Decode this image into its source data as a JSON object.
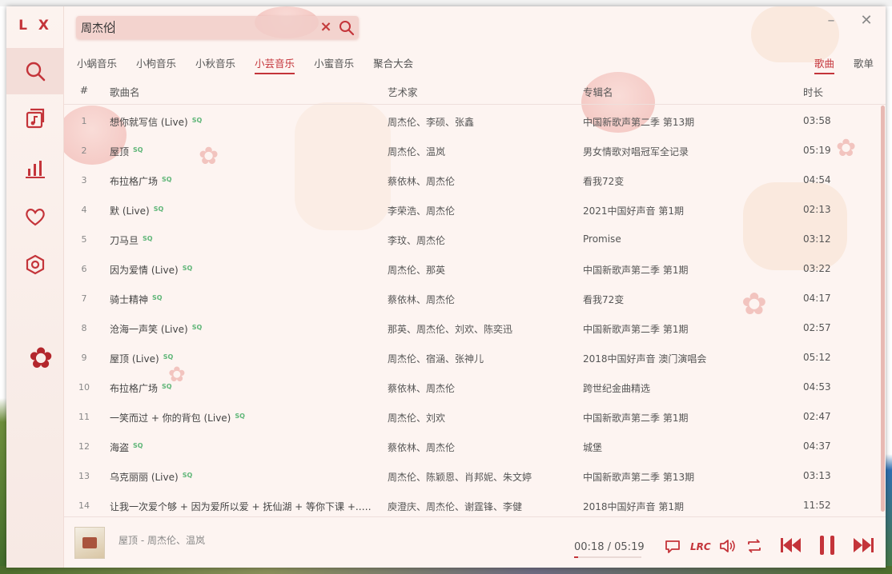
{
  "app": {
    "logo": "L X"
  },
  "sidebar": {
    "items": [
      {
        "name": "search",
        "icon": "search-icon",
        "active": true
      },
      {
        "name": "song-list",
        "icon": "music-list-icon",
        "active": false
      },
      {
        "name": "leaderboard",
        "icon": "bar-chart-icon",
        "active": false
      },
      {
        "name": "favorites",
        "icon": "heart-icon",
        "active": false
      },
      {
        "name": "settings",
        "icon": "settings-icon",
        "active": false
      }
    ]
  },
  "search": {
    "value": "周杰伦"
  },
  "source_tabs": [
    {
      "label": "小蜗音乐",
      "active": false
    },
    {
      "label": "小枸音乐",
      "active": false
    },
    {
      "label": "小秋音乐",
      "active": false
    },
    {
      "label": "小芸音乐",
      "active": true
    },
    {
      "label": "小蜜音乐",
      "active": false
    },
    {
      "label": "聚合大会",
      "active": false
    }
  ],
  "type_tabs": [
    {
      "label": "歌曲",
      "active": true
    },
    {
      "label": "歌单",
      "active": false
    }
  ],
  "table": {
    "headers": {
      "num": "#",
      "name": "歌曲名",
      "artist": "艺术家",
      "album": "专辑名",
      "duration": "时长"
    },
    "quality_badge": "SQ",
    "rows": [
      {
        "num": "1",
        "name": "想你就写信 (Live)",
        "artist": "周杰伦、李硕、张鑫",
        "album": "中国新歌声第二季 第13期",
        "duration": "03:58"
      },
      {
        "num": "2",
        "name": "屋顶",
        "artist": "周杰伦、温岚",
        "album": "男女情歌对唱冠军全记录",
        "duration": "05:19"
      },
      {
        "num": "3",
        "name": "布拉格广场",
        "artist": "蔡依林、周杰伦",
        "album": "看我72变",
        "duration": "04:54"
      },
      {
        "num": "4",
        "name": "默 (Live)",
        "artist": "李荣浩、周杰伦",
        "album": "2021中国好声音 第1期",
        "duration": "02:13"
      },
      {
        "num": "5",
        "name": "刀马旦",
        "artist": "李玟、周杰伦",
        "album": "Promise",
        "duration": "03:12"
      },
      {
        "num": "6",
        "name": "因为爱情 (Live)",
        "artist": "周杰伦、那英",
        "album": "中国新歌声第二季 第1期",
        "duration": "03:22"
      },
      {
        "num": "7",
        "name": "骑士精神",
        "artist": "蔡依林、周杰伦",
        "album": "看我72变",
        "duration": "04:17"
      },
      {
        "num": "8",
        "name": "沧海一声笑 (Live)",
        "artist": "那英、周杰伦、刘欢、陈奕迅",
        "album": "中国新歌声第二季 第1期",
        "duration": "02:57"
      },
      {
        "num": "9",
        "name": "屋顶 (Live)",
        "artist": "周杰伦、宿涵、张神儿",
        "album": "2018中国好声音 澳门演唱会",
        "duration": "05:12"
      },
      {
        "num": "10",
        "name": "布拉格广场",
        "artist": "蔡依林、周杰伦",
        "album": "跨世纪金曲精选",
        "duration": "04:53"
      },
      {
        "num": "11",
        "name": "一笑而过 + 你的背包 (Live)",
        "artist": "周杰伦、刘欢",
        "album": "中国新歌声第二季 第1期",
        "duration": "02:47"
      },
      {
        "num": "12",
        "name": "海盗",
        "artist": "蔡依林、周杰伦",
        "album": "城堡",
        "duration": "04:37"
      },
      {
        "num": "13",
        "name": "乌克丽丽 (Live)",
        "artist": "周杰伦、陈颖恩、肖邦妮、朱文婷",
        "album": "中国新歌声第二季 第13期",
        "duration": "03:13"
      },
      {
        "num": "14",
        "name": "让我一次爱个够 + 因为爱所以爱 + 抚仙湖 + 等你下课 +...",
        "artist": "庾澄庆、周杰伦、谢霆锋、李健",
        "album": "2018中国好声音 第1期",
        "duration": "11:52"
      }
    ]
  },
  "player": {
    "now_playing": "屋顶 - 周杰伦、温岚",
    "current_time": "00:18",
    "separator": "/",
    "total_time": "05:19",
    "progress": 0.056,
    "lrc_label": "LRC",
    "accent": "#c4343a"
  }
}
